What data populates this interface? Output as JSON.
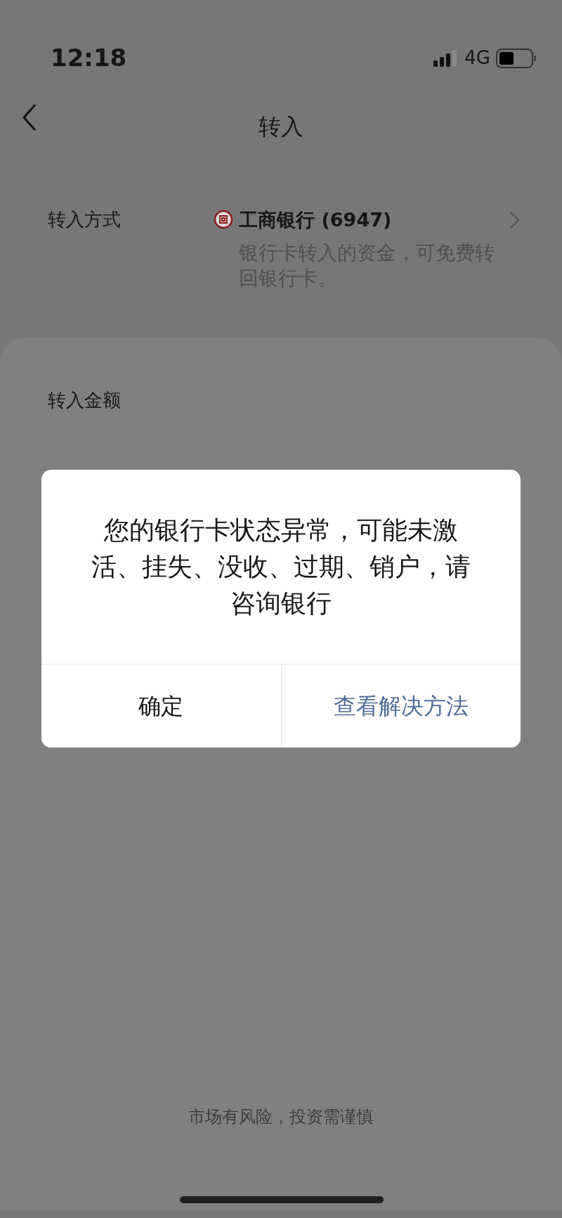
{
  "status_bar": {
    "time": "12:18",
    "network": "4G"
  },
  "nav": {
    "title": "转入"
  },
  "method": {
    "label": "转入方式",
    "bank": "工商银行 (6947)",
    "note": "银行卡转入的资金，可免费转回银行卡。"
  },
  "amount": {
    "label": "转入金额"
  },
  "dialog": {
    "message": "您的银行卡状态异常，可能未激活、挂失、没收、过期、销户，请咨询银行",
    "buttons": [
      {
        "label": "确定",
        "kind": "plain"
      },
      {
        "label": "查看解决方法",
        "kind": "link"
      }
    ]
  },
  "footer": "市场有风险，投资需谨慎"
}
